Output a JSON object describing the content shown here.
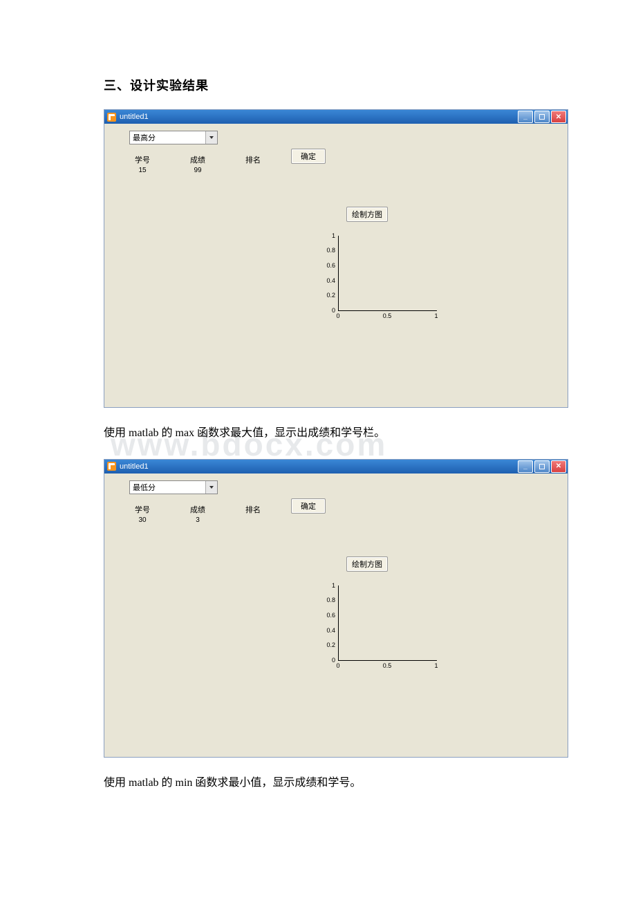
{
  "section_title": "三、设计实验结果",
  "watermark": "www.bdocx.com",
  "windows": [
    {
      "title": "untitled1",
      "dropdown_value": "最高分",
      "columns": {
        "id_label": "学号",
        "id_value": "15",
        "score_label": "成绩",
        "score_value": "99",
        "rank_label": "排名",
        "rank_value": ""
      },
      "ok_button": "确定",
      "plot_button": "绘制方图",
      "chart": {
        "yticks": [
          "1",
          "0.8",
          "0.6",
          "0.4",
          "0.2",
          "0"
        ],
        "xticks": [
          "0",
          "0.5",
          "1"
        ]
      }
    },
    {
      "title": "untitled1",
      "dropdown_value": "最低分",
      "columns": {
        "id_label": "学号",
        "id_value": "30",
        "score_label": "成绩",
        "score_value": "3",
        "rank_label": "排名",
        "rank_value": ""
      },
      "ok_button": "确定",
      "plot_button": "绘制方图",
      "chart": {
        "yticks": [
          "1",
          "0.8",
          "0.6",
          "0.4",
          "0.2",
          "0"
        ],
        "xticks": [
          "0",
          "0.5",
          "1"
        ]
      }
    }
  ],
  "captions": [
    "使用 matlab 的 max 函数求最大值，显示出成绩和学号栏。",
    "使用 matlab 的 min 函数求最小值，显示成绩和学号。"
  ],
  "chart_data": [
    {
      "type": "line",
      "title": "",
      "xlabel": "",
      "ylabel": "",
      "x": [],
      "y": [],
      "xlim": [
        0,
        1
      ],
      "ylim": [
        0,
        1
      ],
      "xticks": [
        0,
        0.5,
        1
      ],
      "yticks": [
        0,
        0.2,
        0.4,
        0.6,
        0.8,
        1
      ]
    },
    {
      "type": "line",
      "title": "",
      "xlabel": "",
      "ylabel": "",
      "x": [],
      "y": [],
      "xlim": [
        0,
        1
      ],
      "ylim": [
        0,
        1
      ],
      "xticks": [
        0,
        0.5,
        1
      ],
      "yticks": [
        0,
        0.2,
        0.4,
        0.6,
        0.8,
        1
      ]
    }
  ]
}
